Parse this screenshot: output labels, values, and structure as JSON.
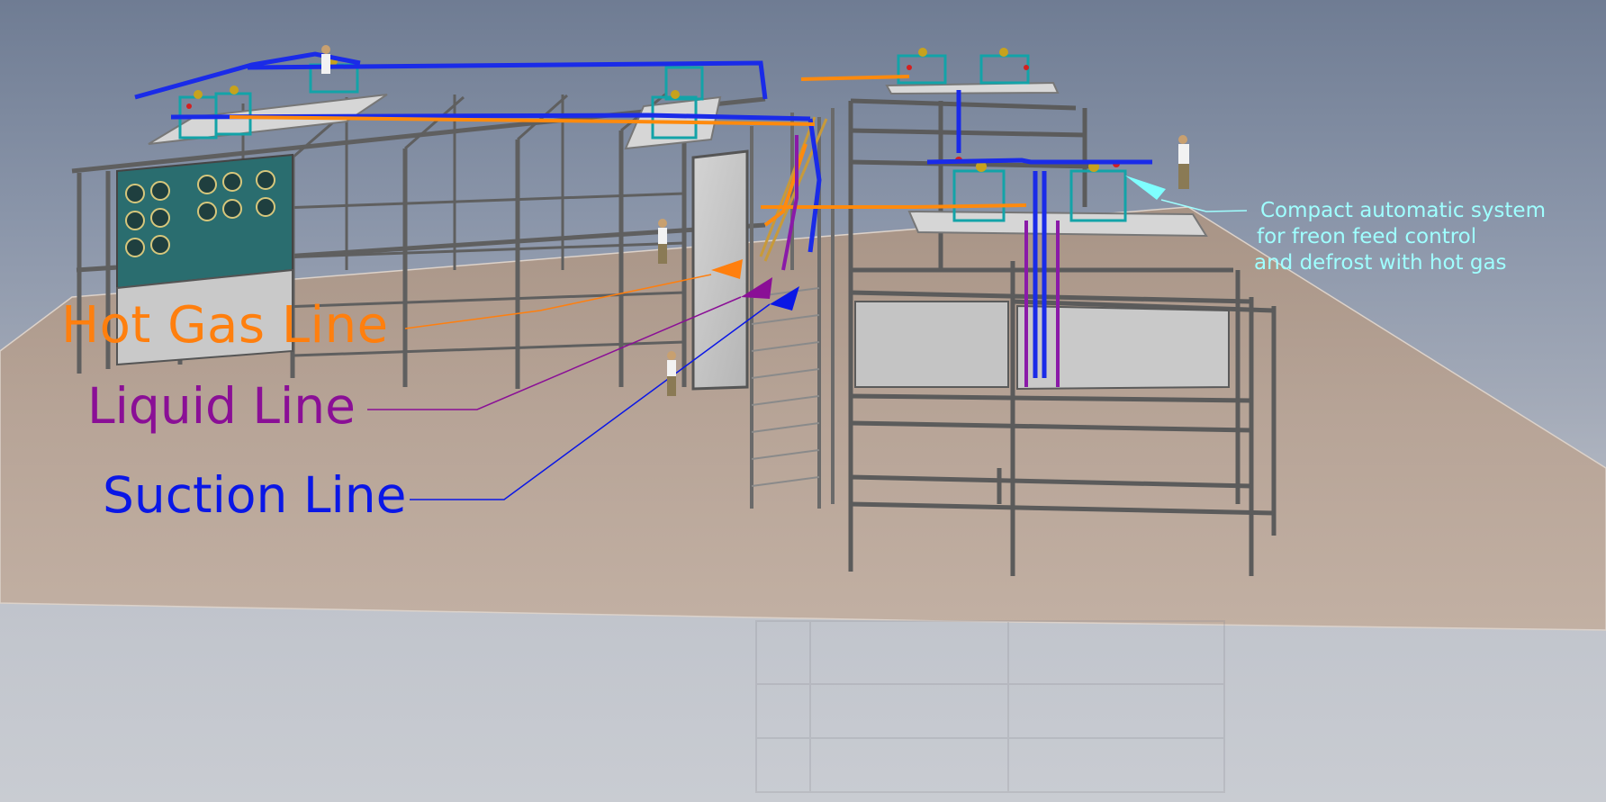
{
  "labels": {
    "hot_gas": "Hot Gas Line",
    "liquid": "Liquid Line",
    "suction": "Suction Line"
  },
  "annotation": {
    "line1": "Compact automatic system",
    "line2": "for freon feed control",
    "line3": "and defrost with hot gas"
  },
  "colors": {
    "hot_gas": "#ff7f0e",
    "liquid": "#8a0f96",
    "suction": "#0a17e6",
    "annotation": "#9fffff",
    "floor": "#b3a196",
    "frame": "#6d6d6d",
    "equipment": "#13a3a8"
  },
  "icons": [
    "worker-figure",
    "control-unit",
    "evaporator-fan"
  ]
}
